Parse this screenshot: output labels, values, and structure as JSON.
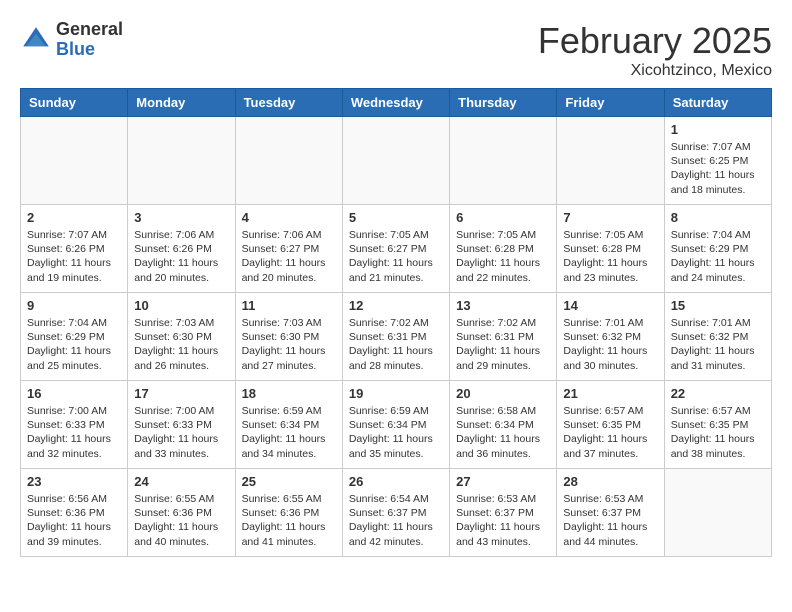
{
  "header": {
    "logo_general": "General",
    "logo_blue": "Blue",
    "month_title": "February 2025",
    "location": "Xicohtzinco, Mexico"
  },
  "weekdays": [
    "Sunday",
    "Monday",
    "Tuesday",
    "Wednesday",
    "Thursday",
    "Friday",
    "Saturday"
  ],
  "weeks": [
    [
      {
        "day": "",
        "info": ""
      },
      {
        "day": "",
        "info": ""
      },
      {
        "day": "",
        "info": ""
      },
      {
        "day": "",
        "info": ""
      },
      {
        "day": "",
        "info": ""
      },
      {
        "day": "",
        "info": ""
      },
      {
        "day": "1",
        "info": "Sunrise: 7:07 AM\nSunset: 6:25 PM\nDaylight: 11 hours\nand 18 minutes."
      }
    ],
    [
      {
        "day": "2",
        "info": "Sunrise: 7:07 AM\nSunset: 6:26 PM\nDaylight: 11 hours\nand 19 minutes."
      },
      {
        "day": "3",
        "info": "Sunrise: 7:06 AM\nSunset: 6:26 PM\nDaylight: 11 hours\nand 20 minutes."
      },
      {
        "day": "4",
        "info": "Sunrise: 7:06 AM\nSunset: 6:27 PM\nDaylight: 11 hours\nand 20 minutes."
      },
      {
        "day": "5",
        "info": "Sunrise: 7:05 AM\nSunset: 6:27 PM\nDaylight: 11 hours\nand 21 minutes."
      },
      {
        "day": "6",
        "info": "Sunrise: 7:05 AM\nSunset: 6:28 PM\nDaylight: 11 hours\nand 22 minutes."
      },
      {
        "day": "7",
        "info": "Sunrise: 7:05 AM\nSunset: 6:28 PM\nDaylight: 11 hours\nand 23 minutes."
      },
      {
        "day": "8",
        "info": "Sunrise: 7:04 AM\nSunset: 6:29 PM\nDaylight: 11 hours\nand 24 minutes."
      }
    ],
    [
      {
        "day": "9",
        "info": "Sunrise: 7:04 AM\nSunset: 6:29 PM\nDaylight: 11 hours\nand 25 minutes."
      },
      {
        "day": "10",
        "info": "Sunrise: 7:03 AM\nSunset: 6:30 PM\nDaylight: 11 hours\nand 26 minutes."
      },
      {
        "day": "11",
        "info": "Sunrise: 7:03 AM\nSunset: 6:30 PM\nDaylight: 11 hours\nand 27 minutes."
      },
      {
        "day": "12",
        "info": "Sunrise: 7:02 AM\nSunset: 6:31 PM\nDaylight: 11 hours\nand 28 minutes."
      },
      {
        "day": "13",
        "info": "Sunrise: 7:02 AM\nSunset: 6:31 PM\nDaylight: 11 hours\nand 29 minutes."
      },
      {
        "day": "14",
        "info": "Sunrise: 7:01 AM\nSunset: 6:32 PM\nDaylight: 11 hours\nand 30 minutes."
      },
      {
        "day": "15",
        "info": "Sunrise: 7:01 AM\nSunset: 6:32 PM\nDaylight: 11 hours\nand 31 minutes."
      }
    ],
    [
      {
        "day": "16",
        "info": "Sunrise: 7:00 AM\nSunset: 6:33 PM\nDaylight: 11 hours\nand 32 minutes."
      },
      {
        "day": "17",
        "info": "Sunrise: 7:00 AM\nSunset: 6:33 PM\nDaylight: 11 hours\nand 33 minutes."
      },
      {
        "day": "18",
        "info": "Sunrise: 6:59 AM\nSunset: 6:34 PM\nDaylight: 11 hours\nand 34 minutes."
      },
      {
        "day": "19",
        "info": "Sunrise: 6:59 AM\nSunset: 6:34 PM\nDaylight: 11 hours\nand 35 minutes."
      },
      {
        "day": "20",
        "info": "Sunrise: 6:58 AM\nSunset: 6:34 PM\nDaylight: 11 hours\nand 36 minutes."
      },
      {
        "day": "21",
        "info": "Sunrise: 6:57 AM\nSunset: 6:35 PM\nDaylight: 11 hours\nand 37 minutes."
      },
      {
        "day": "22",
        "info": "Sunrise: 6:57 AM\nSunset: 6:35 PM\nDaylight: 11 hours\nand 38 minutes."
      }
    ],
    [
      {
        "day": "23",
        "info": "Sunrise: 6:56 AM\nSunset: 6:36 PM\nDaylight: 11 hours\nand 39 minutes."
      },
      {
        "day": "24",
        "info": "Sunrise: 6:55 AM\nSunset: 6:36 PM\nDaylight: 11 hours\nand 40 minutes."
      },
      {
        "day": "25",
        "info": "Sunrise: 6:55 AM\nSunset: 6:36 PM\nDaylight: 11 hours\nand 41 minutes."
      },
      {
        "day": "26",
        "info": "Sunrise: 6:54 AM\nSunset: 6:37 PM\nDaylight: 11 hours\nand 42 minutes."
      },
      {
        "day": "27",
        "info": "Sunrise: 6:53 AM\nSunset: 6:37 PM\nDaylight: 11 hours\nand 43 minutes."
      },
      {
        "day": "28",
        "info": "Sunrise: 6:53 AM\nSunset: 6:37 PM\nDaylight: 11 hours\nand 44 minutes."
      },
      {
        "day": "",
        "info": ""
      }
    ]
  ]
}
